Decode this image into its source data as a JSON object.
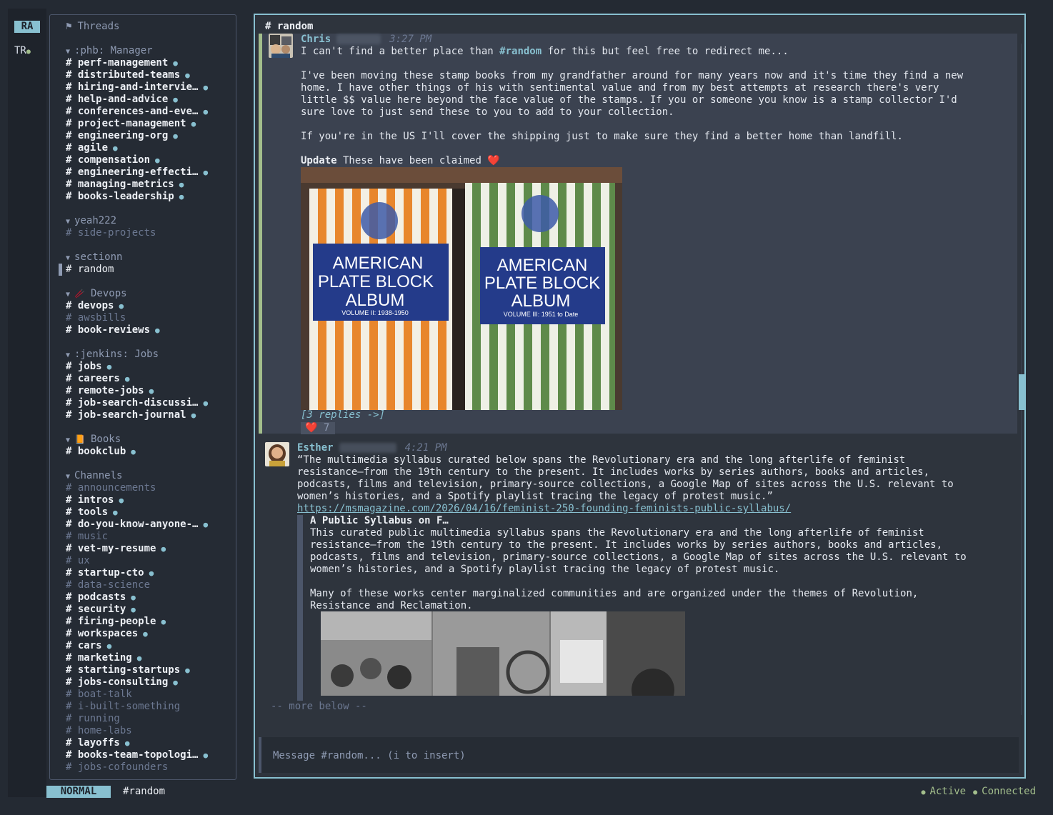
{
  "workspaces": [
    {
      "label": "RA",
      "active": true
    },
    {
      "label": "TR",
      "active": false
    }
  ],
  "sidebar": {
    "header": "Threads",
    "groups": [
      {
        "title": ":phb: Manager",
        "channels": [
          {
            "name": "perf-management",
            "unread": true
          },
          {
            "name": "distributed-teams",
            "unread": true
          },
          {
            "name": "hiring-and-intervie…",
            "unread": true
          },
          {
            "name": "help-and-advice",
            "unread": true
          },
          {
            "name": "conferences-and-eve…",
            "unread": true
          },
          {
            "name": "project-management",
            "unread": true
          },
          {
            "name": "engineering-org",
            "unread": true
          },
          {
            "name": "agile",
            "unread": true
          },
          {
            "name": "compensation",
            "unread": true
          },
          {
            "name": "engineering-effecti…",
            "unread": true
          },
          {
            "name": "managing-metrics",
            "unread": true
          },
          {
            "name": "books-leadership",
            "unread": true
          }
        ]
      },
      {
        "title": "yeah222",
        "channels": [
          {
            "name": "side-projects",
            "unread": false
          }
        ]
      },
      {
        "title": "sectionn",
        "channels": [
          {
            "name": "random",
            "unread": false,
            "active": true
          }
        ]
      },
      {
        "title": "Devops",
        "emoji": "🥢",
        "channels": [
          {
            "name": "devops",
            "unread": true
          },
          {
            "name": "awsbills",
            "unread": false
          },
          {
            "name": "book-reviews",
            "unread": true
          }
        ]
      },
      {
        "title": ":jenkins: Jobs",
        "channels": [
          {
            "name": "jobs",
            "unread": true
          },
          {
            "name": "careers",
            "unread": true
          },
          {
            "name": "remote-jobs",
            "unread": true
          },
          {
            "name": "job-search-discussi…",
            "unread": true
          },
          {
            "name": "job-search-journal",
            "unread": true
          }
        ]
      },
      {
        "title": "Books",
        "emoji": "📙",
        "channels": [
          {
            "name": "bookclub",
            "unread": true
          }
        ]
      },
      {
        "title": "Channels",
        "channels": [
          {
            "name": "announcements",
            "unread": false
          },
          {
            "name": "intros",
            "unread": true
          },
          {
            "name": "tools",
            "unread": true
          },
          {
            "name": "do-you-know-anyone-…",
            "unread": true
          },
          {
            "name": "music",
            "unread": false
          },
          {
            "name": "vet-my-resume",
            "unread": true
          },
          {
            "name": "ux",
            "unread": false
          },
          {
            "name": "startup-cto",
            "unread": true
          },
          {
            "name": "data-science",
            "unread": false
          },
          {
            "name": "podcasts",
            "unread": true
          },
          {
            "name": "security",
            "unread": true
          },
          {
            "name": "firing-people",
            "unread": true
          },
          {
            "name": "workspaces",
            "unread": true
          },
          {
            "name": "cars",
            "unread": true
          },
          {
            "name": "marketing",
            "unread": true
          },
          {
            "name": "starting-startups",
            "unread": true
          },
          {
            "name": "jobs-consulting",
            "unread": true
          },
          {
            "name": "boat-talk",
            "unread": false
          },
          {
            "name": "i-built-something",
            "unread": false
          },
          {
            "name": "running",
            "unread": false
          },
          {
            "name": "home-labs",
            "unread": false
          },
          {
            "name": "layoffs",
            "unread": true
          },
          {
            "name": "books-team-topologi…",
            "unread": true
          },
          {
            "name": "jobs-cofounders",
            "unread": false
          }
        ]
      }
    ]
  },
  "channel": {
    "header": "# random"
  },
  "messages": [
    {
      "author": "Chris",
      "time": "3:27 PM",
      "line1_pre": "I can't find a better place than ",
      "line1_link": "#random",
      "line1_post": " for this but feel free to redirect me...",
      "para2": "I've been moving these stamp books from my grandfather around for many years now and it's time they find a new\nhome. I have other things of his with sentimental value and from my best attempts at research there's very\nlittle $$ value here beyond the face value of the stamps. If you or someone you know is a stamp collector I'd\nsure love to just send these to you to add to your collection.",
      "para3": "If you're in the US I'll cover the shipping just to make sure they find a better home than landfill.",
      "update_label": "Update",
      "update_text": " These have been claimed ",
      "update_emoji": "❤️",
      "image": {
        "book1_title": [
          "AMERICAN",
          "PLATE BLOCK",
          "ALBUM"
        ],
        "book1_volume": "VOLUME II: 1938-1950",
        "book2_title": [
          "AMERICAN",
          "PLATE BLOCK",
          "ALBUM"
        ],
        "book2_volume": "VOLUME III: 1951 to Date"
      },
      "replies": "[3 replies ->]",
      "reaction_emoji": "❤️",
      "reaction_count": "7"
    },
    {
      "author": "Esther",
      "time": "4:21 PM",
      "text": "“The multimedia syllabus curated below spans the Revolutionary era and the long afterlife of feminist\nresistance—from the 19th century to the present. It includes works by series authors, books and articles,\npodcasts, films and television, primary-source collections, a Google Map of sites across the U.S. relevant to\nwomen’s histories, and a Spotify playlist tracing the legacy of protest music.”",
      "url": "https://msmagazine.com/2026/04/16/feminist-250-founding-feminists-public-syllabus/",
      "preview_title": "A Public Syllabus on F…",
      "preview_body": "This curated public multimedia syllabus spans the Revolutionary era and the long afterlife of feminist\nresistance—from the 19th century to the present. It includes works by series authors, books and articles,\npodcasts, films and television, primary-source collections, a Google Map of sites across the U.S. relevant to\nwomen’s histories, and a Spotify playlist tracing the legacy of protest music.\n\nMany of these works center marginalized communities and are organized under the themes of Revolution,\nResistance and Reclamation."
    }
  ],
  "more_below": "-- more below --",
  "input": {
    "placeholder": "Message #random... (i to insert)"
  },
  "status": {
    "mode": "NORMAL",
    "channel": "#random",
    "presence": "Active",
    "connection": "Connected"
  },
  "colors": {
    "accent": "#88c0d0",
    "online": "#a3be8c",
    "background": "#242a33"
  }
}
